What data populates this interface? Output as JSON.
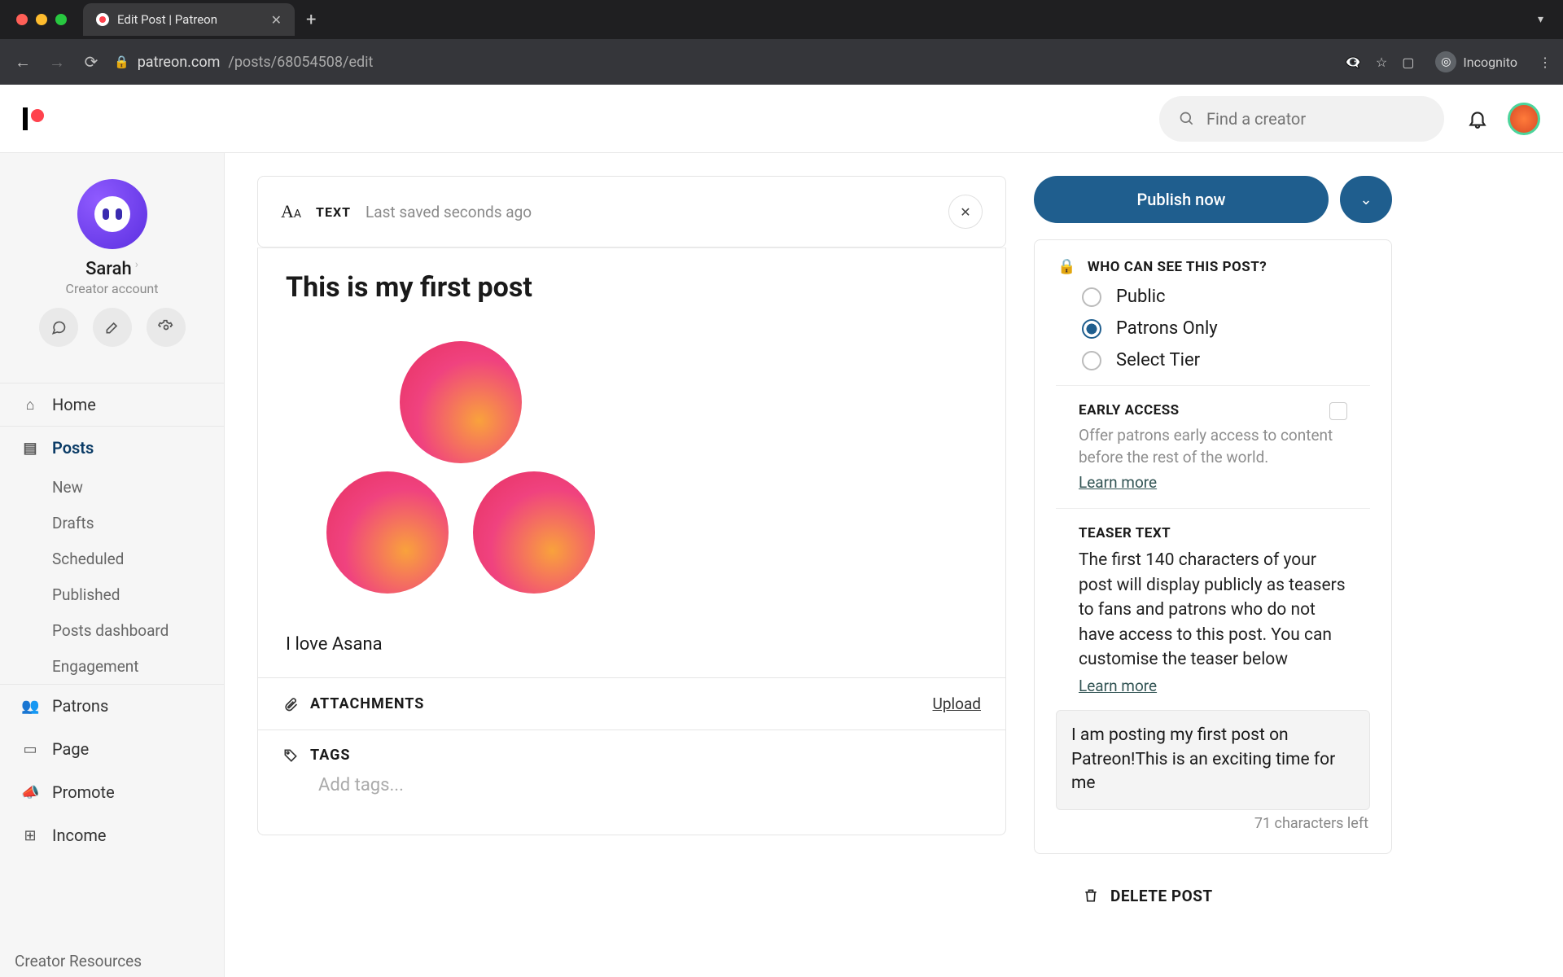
{
  "browser": {
    "tab_title": "Edit Post | Patreon",
    "url_host": "patreon.com",
    "url_path": "/posts/68054508/edit",
    "incognito_label": "Incognito"
  },
  "header": {
    "search_placeholder": "Find a creator"
  },
  "sidebar": {
    "name": "Sarah",
    "account_type": "Creator account",
    "items": {
      "home": "Home",
      "posts": "Posts",
      "patrons": "Patrons",
      "page": "Page",
      "promote": "Promote",
      "income": "Income"
    },
    "posts_sub": {
      "new": "New",
      "drafts": "Drafts",
      "scheduled": "Scheduled",
      "published": "Published",
      "dashboard": "Posts dashboard",
      "engagement": "Engagement"
    },
    "resources": "Creator Resources"
  },
  "editor": {
    "type_label": "TEXT",
    "saved_label": "Last saved seconds ago",
    "title": "This is my first post",
    "body": "I love Asana",
    "attachments_label": "ATTACHMENTS",
    "upload_label": "Upload",
    "tags_label": "TAGS",
    "tags_placeholder": "Add tags..."
  },
  "right": {
    "publish": "Publish now",
    "visibility_title": "WHO CAN SEE THIS POST?",
    "visibility": {
      "public": "Public",
      "patrons": "Patrons Only",
      "tier": "Select Tier"
    },
    "early": {
      "title": "EARLY ACCESS",
      "desc": "Offer patrons early access to content before the rest of the world.",
      "learn": "Learn more"
    },
    "teaser": {
      "title": "TEASER TEXT",
      "desc": "The first 140 characters of your post will display publicly as teasers to fans and patrons who do not have access to this post. You can customise the teaser below",
      "learn": "Learn more",
      "value": "I am posting my first post on Patreon!This is an exciting time for me",
      "counter": "71 characters left"
    },
    "delete": "DELETE POST"
  }
}
